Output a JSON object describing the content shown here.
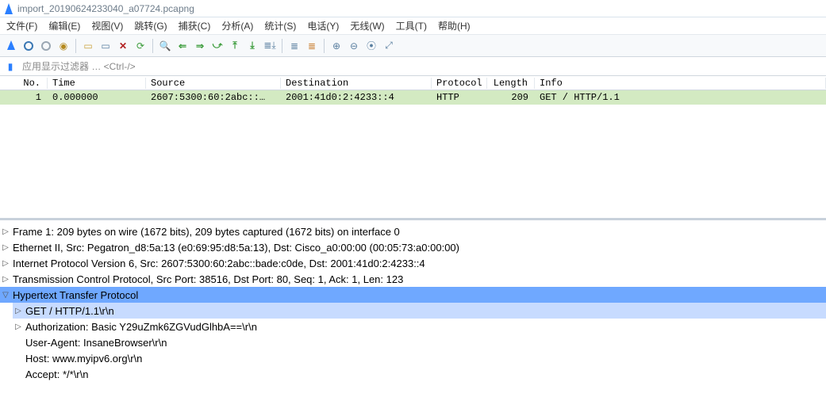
{
  "window": {
    "title": "import_20190624233040_a07724.pcapng"
  },
  "menu": {
    "file": "文件(F)",
    "edit": "编辑(E)",
    "view": "视图(V)",
    "go": "跳转(G)",
    "capture": "捕获(C)",
    "analyze": "分析(A)",
    "stats": "统计(S)",
    "telephony": "电话(Y)",
    "wireless": "无线(W)",
    "tools": "工具(T)",
    "help": "帮助(H)"
  },
  "filter": {
    "placeholder": "应用显示过滤器 … <Ctrl-/>"
  },
  "columns": {
    "no": "No.",
    "time": "Time",
    "src": "Source",
    "dst": "Destination",
    "proto": "Protocol",
    "len": "Length",
    "info": "Info"
  },
  "packets": [
    {
      "no": "1",
      "time": "0.000000",
      "src": "2607:5300:60:2abc::…",
      "dst": "2001:41d0:2:4233::4",
      "proto": "HTTP",
      "len": "209",
      "info": "GET / HTTP/1.1"
    }
  ],
  "details": {
    "frame": "Frame 1: 209 bytes on wire (1672 bits), 209 bytes captured (1672 bits) on interface 0",
    "eth": "Ethernet II, Src: Pegatron_d8:5a:13 (e0:69:95:d8:5a:13), Dst: Cisco_a0:00:00 (00:05:73:a0:00:00)",
    "ipv6": "Internet Protocol Version 6, Src: 2607:5300:60:2abc::bade:c0de, Dst: 2001:41d0:2:4233::4",
    "tcp": "Transmission Control Protocol, Src Port: 38516, Dst Port: 80, Seq: 1, Ack: 1, Len: 123",
    "http": "Hypertext Transfer Protocol",
    "getline": "GET / HTTP/1.1\\r\\n",
    "auth": "Authorization: Basic Y29uZmk6ZGVudGlhbA==\\r\\n",
    "ua": "User-Agent: InsaneBrowser\\r\\n",
    "host": "Host: www.myipv6.org\\r\\n",
    "accept": "Accept: */*\\r\\n"
  }
}
